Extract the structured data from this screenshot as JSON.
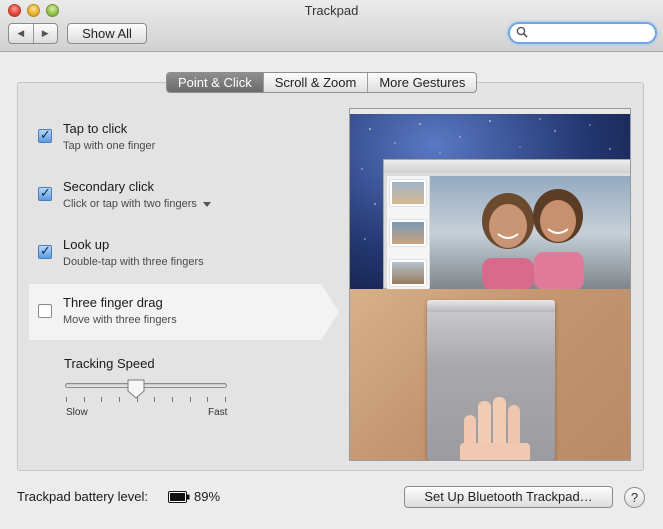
{
  "window": {
    "title": "Trackpad"
  },
  "toolbar": {
    "back_label": "◀",
    "forward_label": "▶",
    "show_all_label": "Show All",
    "search": {
      "value": "",
      "placeholder": ""
    }
  },
  "tabs": [
    {
      "label": "Point & Click",
      "active": true
    },
    {
      "label": "Scroll & Zoom",
      "active": false
    },
    {
      "label": "More Gestures",
      "active": false
    }
  ],
  "options": [
    {
      "title": "Tap to click",
      "subtitle": "Tap with one finger",
      "checked": true,
      "has_dropdown": false
    },
    {
      "title": "Secondary click",
      "subtitle": "Click or tap with two fingers",
      "checked": true,
      "has_dropdown": true
    },
    {
      "title": "Look up",
      "subtitle": "Double-tap with three fingers",
      "checked": true,
      "has_dropdown": false
    },
    {
      "title": "Three finger drag",
      "subtitle": "Move with three fingers",
      "checked": false,
      "has_dropdown": false,
      "selected": true
    }
  ],
  "tracking_speed": {
    "label": "Tracking Speed",
    "min_label": "Slow",
    "max_label": "Fast",
    "value_fraction": 0.44,
    "tick_count": 10
  },
  "footer": {
    "battery_label": "Trackpad battery level:",
    "battery_value": "89%",
    "bluetooth_button": "Set Up Bluetooth Trackpad…",
    "help_label": "?"
  },
  "icons": {
    "search": "magnifier-icon",
    "battery": "battery-icon",
    "checkbox_tick": "checkmark-icon"
  },
  "colors": {
    "active_tab": "#777777",
    "checkbox_checked": "#5d9ce0",
    "search_focus": "#6fa7e6"
  }
}
